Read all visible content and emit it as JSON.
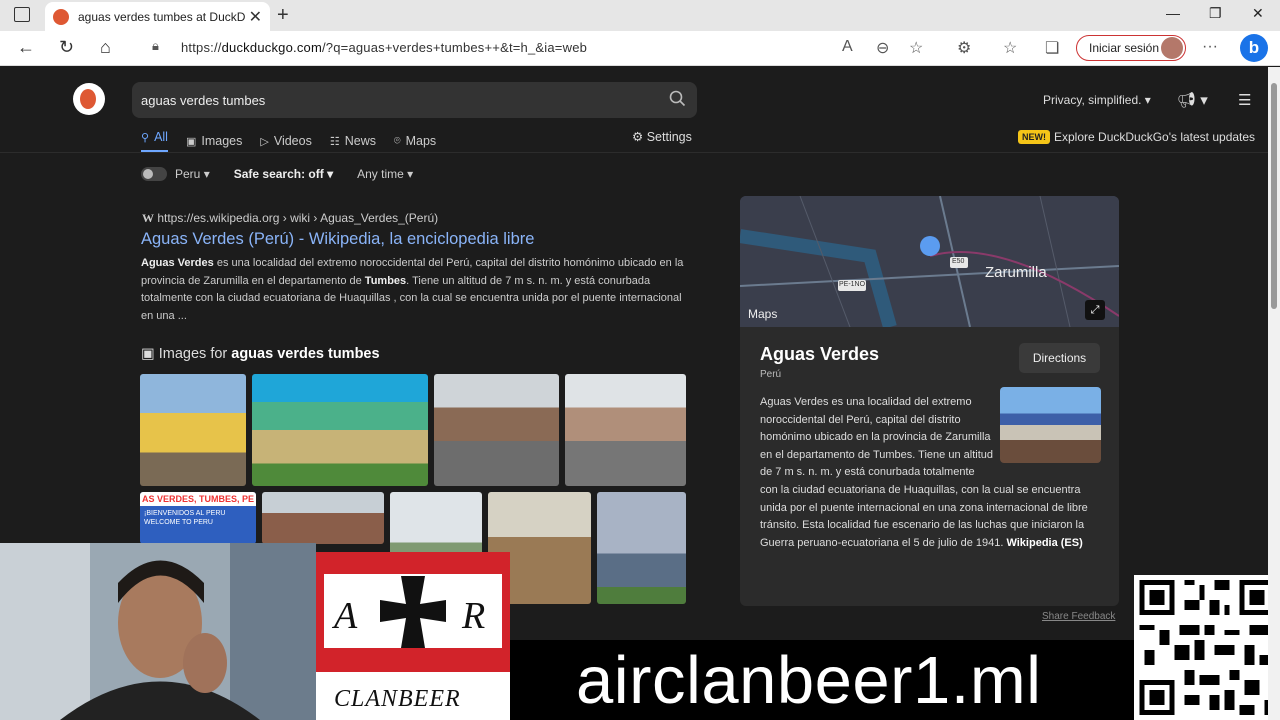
{
  "browser": {
    "tab_title": "aguas verdes tumbes at DuckDuckGo",
    "url_prefix": "https://",
    "url_host": "duckduckgo.com",
    "url_path": "/?q=aguas+verdes+tumbes++&t=h_&ia=web",
    "signin_label": "Iniciar sesión"
  },
  "search": {
    "query": "aguas verdes tumbes",
    "privacy_label": "Privacy, simplified.",
    "tabs": [
      "All",
      "Images",
      "Videos",
      "News",
      "Maps"
    ],
    "settings_label": "Settings",
    "new_badge": "NEW!",
    "explore_label": "Explore DuckDuckGo's latest updates"
  },
  "filters": {
    "region": "Peru",
    "safe_search": "Safe search: off",
    "time": "Any time"
  },
  "result": {
    "url": "https://es.wikipedia.org › wiki › Aguas_Verdes_(Perú)",
    "title": "Aguas Verdes (Perú) - Wikipedia, la enciclopedia libre",
    "snippet_bold1": "Aguas Verdes",
    "snippet_part1": " es una localidad del extremo noroccidental del Perú, capital del distrito homónimo ubicado en la provincia de Zarumilla en el departamento de ",
    "snippet_bold2": "Tumbes",
    "snippet_part2": ". Tiene un altitud de 7 m s. n. m. y está conurbada totalmente con la ciudad ecuatoriana de Huaquillas , con la cual se encuentra unida por el puente internacional en una ..."
  },
  "images": {
    "heading_prefix": "Images for ",
    "heading_query": "aguas verdes tumbes",
    "thumb_text": "AS VERDES, TUMBES, PE",
    "thumb_welcome": "¡BIENVENIDOS AL PERU WELCOME TO PERU"
  },
  "knowledge_panel": {
    "map_city": "Zarumilla",
    "map_road1": "PE-1NO",
    "map_road2": "E50",
    "map_brand": "Maps",
    "title": "Aguas Verdes",
    "subtitle": "Perú",
    "directions_label": "Directions",
    "description": "Aguas Verdes es una localidad del extremo noroccidental del Perú, capital del distrito homónimo ubicado en la provincia de Zarumilla en el departamento de Tumbes. Tiene un altitud de 7 m s. n. m. y está conurbada totalmente con la ciudad ecuatoriana de Huaquillas, con la cual se encuentra unida por el puente internacional en una zona internacional de libre tránsito. Esta localidad fue escenario de las luchas que iniciaron la Guerra peruano-ecuatoriana el 5 de julio de 1941.",
    "source_label": "Wikipedia (ES)",
    "feedback_label": "Share Feedback"
  },
  "overlay": {
    "banner_text": "airclanbeer1.ml",
    "logo_letter_left": "A",
    "logo_letter_right": "R",
    "logo_caption": "CLANBEER"
  }
}
